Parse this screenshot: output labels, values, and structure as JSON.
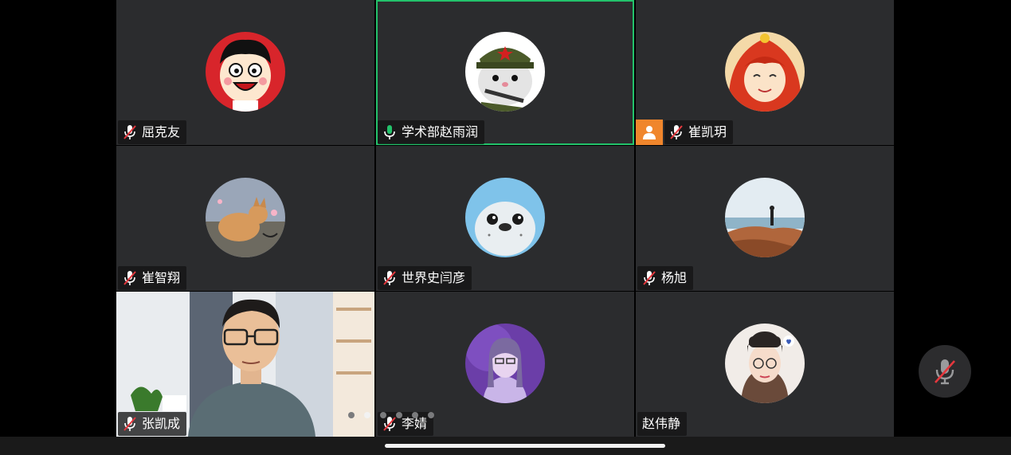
{
  "participants": [
    {
      "name": "屈克友",
      "mic": "muted",
      "avatar": "cartoon-boy-avatar"
    },
    {
      "name": "学术部赵雨润",
      "mic": "active",
      "avatar": "hamster-soldier-avatar",
      "speaking": true
    },
    {
      "name": "崔凯玥",
      "mic": "muted",
      "avatar": "red-hair-girl-avatar",
      "host": true
    },
    {
      "name": "崔智翔",
      "mic": "muted",
      "avatar": "corgi-avatar"
    },
    {
      "name": "世界史闫彦",
      "mic": "muted",
      "avatar": "seal-avatar"
    },
    {
      "name": "杨旭",
      "mic": "muted",
      "avatar": "seaside-person-avatar"
    },
    {
      "name": "张凯成",
      "mic": "muted",
      "avatar": "live-video"
    },
    {
      "name": "李婧",
      "mic": "muted",
      "avatar": "purple-portrait-avatar"
    },
    {
      "name": "赵伟静",
      "mic": "none",
      "avatar": "girl-with-glasses-avatar"
    }
  ],
  "pagination": {
    "total": 6,
    "current": 2
  },
  "colors": {
    "speaking_border": "#23c26b",
    "host_badge": "#f0862c",
    "tile_bg": "#2b2c2e",
    "mic_active": "#23c26b"
  }
}
